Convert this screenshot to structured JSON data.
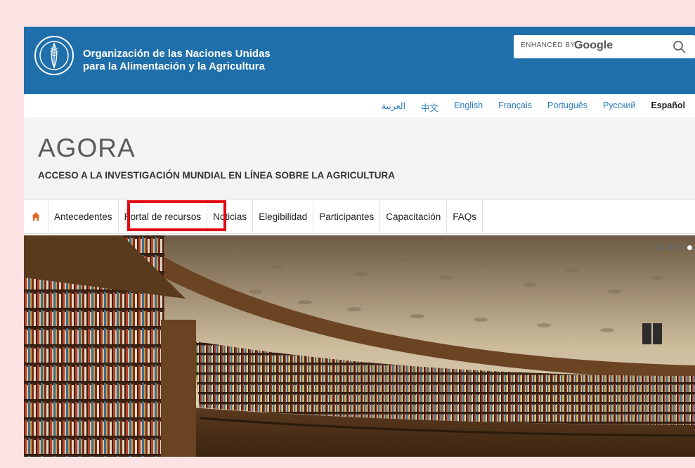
{
  "header": {
    "org_line1": "Organización de las Naciones Unidas",
    "org_line2": "para la Alimentación y la Agricultura",
    "search_prefix": "ENHANCED BY",
    "search_brand": "Google",
    "colors": {
      "topbar": "#1f6fab",
      "highlight": "#e30613",
      "link": "#2a7bbf"
    }
  },
  "languages": [
    {
      "label": "العربية",
      "active": false
    },
    {
      "label": "中文",
      "active": false
    },
    {
      "label": "English",
      "active": false
    },
    {
      "label": "Français",
      "active": false
    },
    {
      "label": "Português",
      "active": false
    },
    {
      "label": "Русский",
      "active": false
    },
    {
      "label": "Español",
      "active": true
    }
  ],
  "site": {
    "title": "AGORA",
    "subtitle": "ACCESO A LA INVESTIGACIÓN MUNDIAL EN LÍNEA SOBRE LA AGRICULTURA"
  },
  "nav": {
    "home_icon": "home-icon",
    "items": [
      {
        "label": "Antecedentes"
      },
      {
        "label": "Portal de recursos",
        "highlighted": true
      },
      {
        "label": "Noticias"
      },
      {
        "label": "Elegibilidad"
      },
      {
        "label": "Participantes"
      },
      {
        "label": "Capacitación"
      },
      {
        "label": "FAQs"
      }
    ]
  },
  "hero": {
    "carousel_slides": 4,
    "active_slide": 4
  }
}
